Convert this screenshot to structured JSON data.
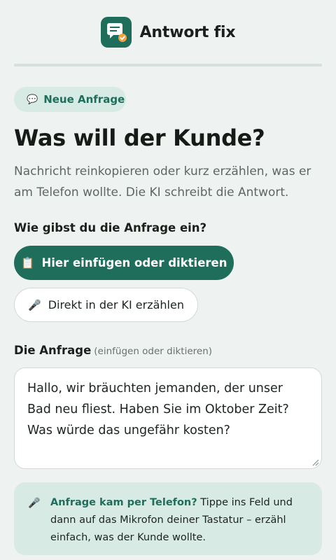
{
  "app": {
    "title": "Antwort fix",
    "logo_icon": "chat-check-icon",
    "brand_color": "#1f6e5b"
  },
  "badge": {
    "icon": "speech-bubble-icon",
    "label": "Neue Anfrage"
  },
  "page": {
    "title": "Was will der Kunde?",
    "subtitle": "Nachricht reinkopieren oder kurz erzählen, was er am Telefon wollte. Die KI schreibt die Antwort."
  },
  "input_method": {
    "label": "Wie gibst du die Anfrage ein?",
    "primary": {
      "icon": "clipboard-icon",
      "glyph": "📋",
      "label": "Hier einfügen oder diktieren"
    },
    "secondary": {
      "icon": "microphone-icon",
      "glyph": "🎤",
      "label": "Direkt in der KI erzählen"
    }
  },
  "request_field": {
    "label": "Die Anfrage",
    "hint": "(einfügen oder diktieren)",
    "value": "Hallo, wir bräuchten jemanden, der unser Bad neu fliest. Haben Sie im Oktober Zeit? Was würde das ungefähr kosten?"
  },
  "tip": {
    "icon": "microphone-icon",
    "glyph": "🎤",
    "strong": "Anfrage kam per Telefon?",
    "text": " Tippe ins Feld und dann auf das Mikrofon deiner Tastatur – erzähl einfach, was der Kunde wollte."
  }
}
